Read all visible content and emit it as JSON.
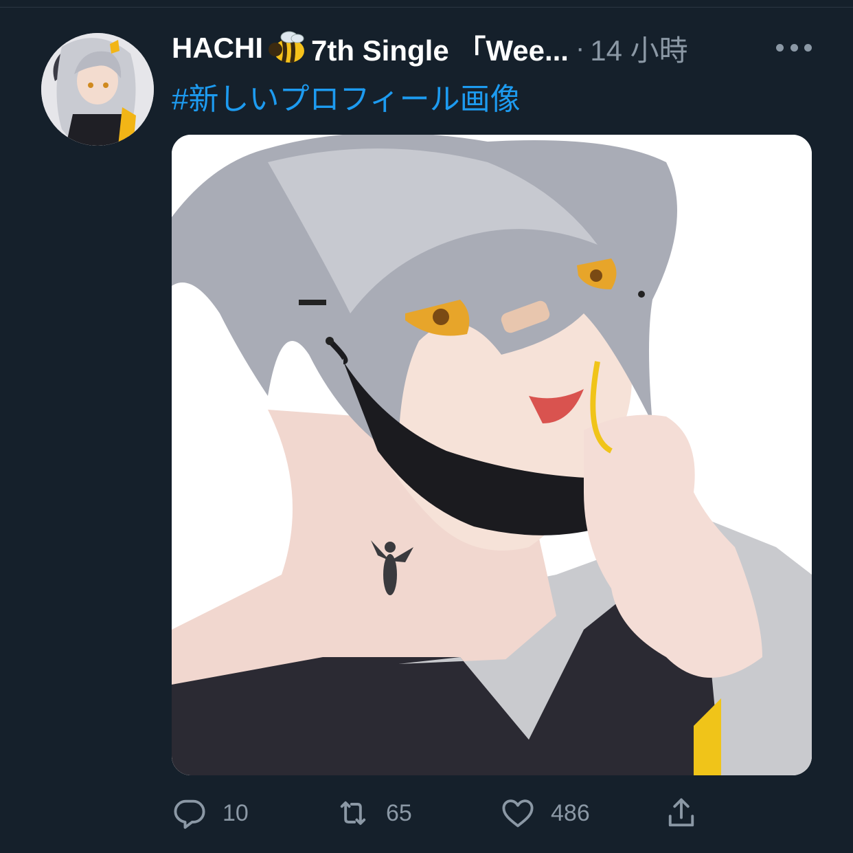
{
  "tweet": {
    "display_name": "HACHI",
    "display_name_suffix": "7th Single 「Wee...",
    "separator": "·",
    "timestamp": "14 小時",
    "hashtag": "#新しいプロフィール画像",
    "media_alt": "Illustration of a silver-haired character pulling down a black mask"
  },
  "actions": {
    "replies": "10",
    "retweets": "65",
    "likes": "486"
  },
  "icons": {
    "reply": "reply-icon",
    "retweet": "retweet-icon",
    "like": "heart-icon",
    "share": "share-icon",
    "more": "more-icon",
    "name_emoji": "bee-icon"
  },
  "colors": {
    "background": "#15202b",
    "text_primary": "#ffffff",
    "text_secondary": "#8b98a5",
    "link": "#1d9bf0"
  }
}
